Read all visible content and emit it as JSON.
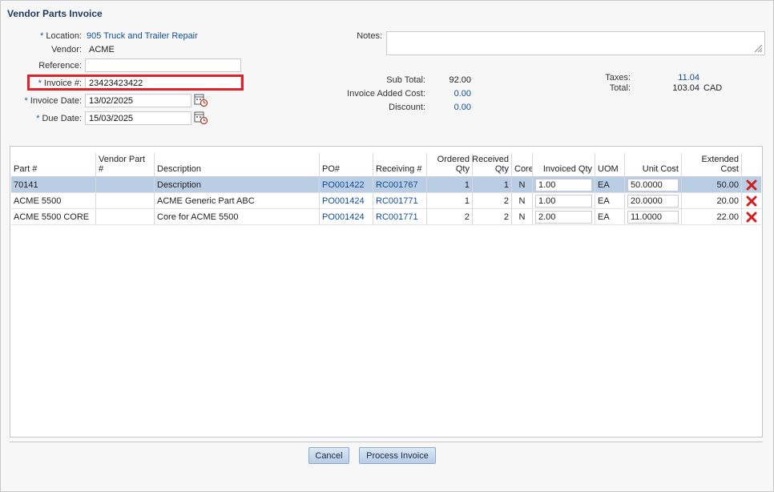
{
  "title": "Vendor Parts Invoice",
  "form": {
    "location_label": "Location:",
    "location_value": "905 Truck and Trailer Repair",
    "vendor_label": "Vendor:",
    "vendor_value": "ACME",
    "reference_label": "Reference:",
    "reference_value": "",
    "invoice_label": "Invoice #:",
    "invoice_value": "23423423422",
    "invoice_date_label": "Invoice Date:",
    "invoice_date_value": "13/02/2025",
    "due_date_label": "Due Date:",
    "due_date_value": "15/03/2025",
    "required_marker": "*"
  },
  "notes": {
    "label": "Notes:",
    "value": ""
  },
  "totals": {
    "subtotal_label": "Sub Total:",
    "subtotal_value": "92.00",
    "added_cost_label": "Invoice Added Cost:",
    "added_cost_value": "0.00",
    "discount_label": "Discount:",
    "discount_value": "0.00",
    "taxes_label": "Taxes:",
    "taxes_value": "11.04",
    "total_label": "Total:",
    "total_value": "103.04",
    "currency": "CAD"
  },
  "table": {
    "headers": [
      "Part #",
      "Vendor Part #",
      "Description",
      "PO#",
      "Receiving #",
      "Ordered Qty",
      "Received Qty",
      "Core",
      "Invoiced Qty",
      "UOM",
      "Unit Cost",
      "Extended Cost"
    ],
    "rows": [
      {
        "part": "70141",
        "vendor_part": "",
        "description": "Description",
        "po": "PO001422",
        "receiving": "RC001767",
        "ordered": "1",
        "received": "1",
        "core": "N",
        "invoiced": "1.00",
        "uom": "EA",
        "unit_cost": "50.0000",
        "extended": "50.00"
      },
      {
        "part": "ACME 5500",
        "vendor_part": "",
        "description": "ACME Generic Part ABC",
        "po": "PO001424",
        "receiving": "RC001771",
        "ordered": "1",
        "received": "2",
        "core": "N",
        "invoiced": "1.00",
        "uom": "EA",
        "unit_cost": "20.0000",
        "extended": "20.00"
      },
      {
        "part": "ACME 5500 CORE",
        "vendor_part": "",
        "description": "Core for ACME 5500",
        "po": "PO001424",
        "receiving": "RC001771",
        "ordered": "2",
        "received": "2",
        "core": "N",
        "invoiced": "2.00",
        "uom": "EA",
        "unit_cost": "11.0000",
        "extended": "22.00"
      }
    ]
  },
  "buttons": {
    "cancel": "Cancel",
    "process": "Process Invoice"
  },
  "colors": {
    "link": "#0f4f96",
    "highlight": "#e0202a",
    "selected_row": "#b9cde5",
    "delete": "#d0201c"
  }
}
